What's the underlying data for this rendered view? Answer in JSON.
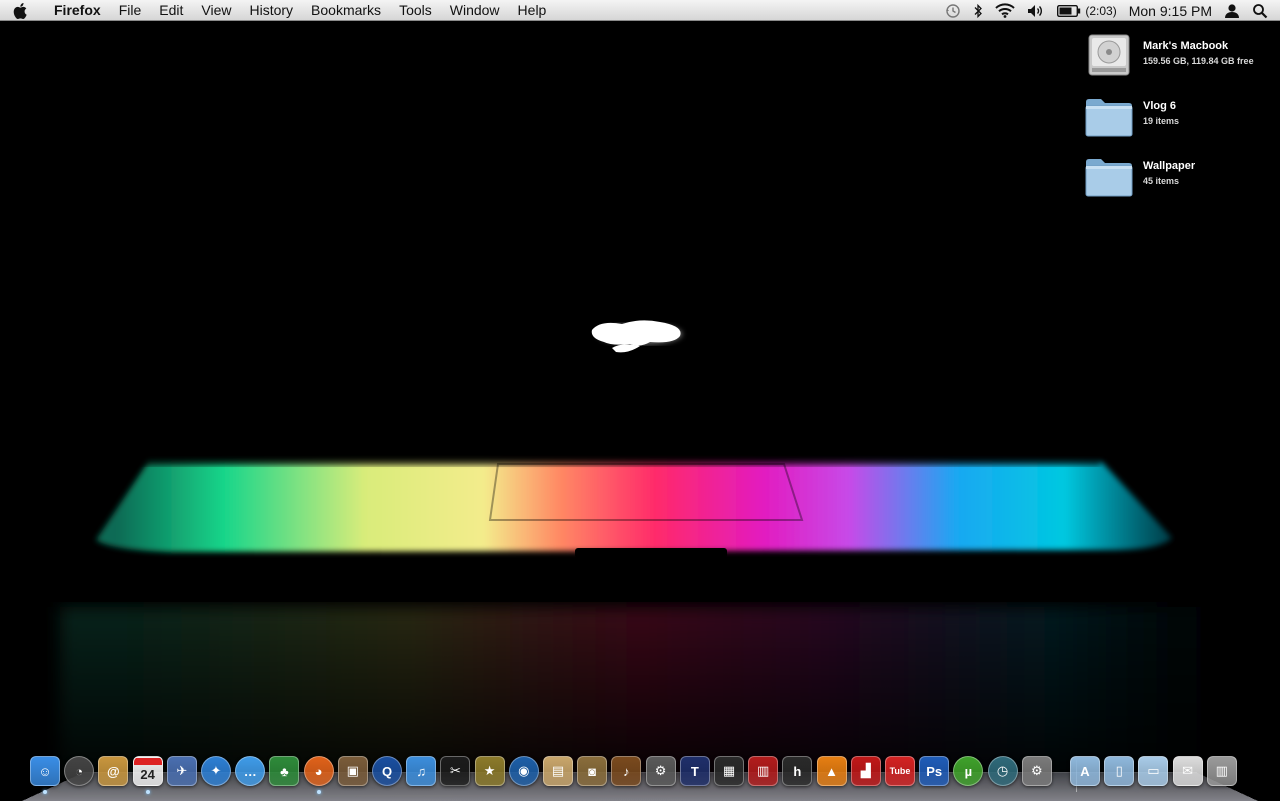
{
  "menubar": {
    "app_name": "Firefox",
    "menus": [
      "File",
      "Edit",
      "View",
      "History",
      "Bookmarks",
      "Tools",
      "Window",
      "Help"
    ],
    "battery_time": "(2:03)",
    "clock": "Mon 9:15 PM",
    "status_icons": [
      "time-machine-icon",
      "bluetooth-icon",
      "wifi-icon",
      "volume-icon",
      "battery-icon",
      "user-icon",
      "spotlight-icon"
    ]
  },
  "desktop": {
    "icons": [
      {
        "name": "Mark's Macbook",
        "info": "159.56 GB, 119.84 GB free",
        "icon": "hard-drive-icon"
      },
      {
        "name": "Vlog 6",
        "info": "19 items",
        "icon": "folder-icon"
      },
      {
        "name": "Wallpaper",
        "info": "45 items",
        "icon": "folder-icon"
      }
    ]
  },
  "dock": {
    "calendar_day": "24",
    "items": [
      {
        "icon": "finder-icon",
        "color": "#3a8ee6",
        "glyph": "☺",
        "running": true
      },
      {
        "icon": "dashboard-icon",
        "color": "#444444",
        "glyph": "◔",
        "running": false
      },
      {
        "icon": "address-book-icon",
        "color": "#c8963e",
        "glyph": "@",
        "running": false
      },
      {
        "icon": "ical-icon",
        "color": "#f2f2f2",
        "glyph": "",
        "running": true
      },
      {
        "icon": "mail-icon",
        "color": "#4a6fb0",
        "glyph": "✈",
        "running": false
      },
      {
        "icon": "safari-icon",
        "color": "#2d7fd4",
        "glyph": "✦",
        "running": false
      },
      {
        "icon": "ichat-icon",
        "color": "#3f9be8",
        "glyph": "…",
        "running": false
      },
      {
        "icon": "adium-icon",
        "color": "#2e8b3a",
        "glyph": "♣",
        "running": false
      },
      {
        "icon": "firefox-icon",
        "color": "#e0621a",
        "glyph": "◕",
        "running": true
      },
      {
        "icon": "preview-icon",
        "color": "#7a5c3a",
        "glyph": "▣",
        "running": false
      },
      {
        "icon": "quicktime-icon",
        "color": "#1a4fa0",
        "glyph": "Q",
        "running": false
      },
      {
        "icon": "itunes-icon",
        "color": "#3c8edc",
        "glyph": "♫",
        "running": false
      },
      {
        "icon": "final-cut-icon",
        "color": "#1c1c1c",
        "glyph": "✂",
        "running": false
      },
      {
        "icon": "imovie-icon",
        "color": "#8c7a2a",
        "glyph": "★",
        "running": false
      },
      {
        "icon": "dvd-player-icon",
        "color": "#1d5fa8",
        "glyph": "◉",
        "running": false
      },
      {
        "icon": "keynote-icon",
        "color": "#c9a66b",
        "glyph": "▤",
        "running": false
      },
      {
        "icon": "iphoto-icon",
        "color": "#8a6d3b",
        "glyph": "◙",
        "running": false
      },
      {
        "icon": "garageband-icon",
        "color": "#7a4a1e",
        "glyph": "♪",
        "running": false
      },
      {
        "icon": "compressor-icon",
        "color": "#5a5a5a",
        "glyph": "⚙",
        "running": false
      },
      {
        "icon": "livetype-icon",
        "color": "#1f2f6a",
        "glyph": "T",
        "running": false
      },
      {
        "icon": "photo-booth-icon",
        "color": "#2a2a2a",
        "glyph": "▦",
        "running": false
      },
      {
        "icon": "front-row-icon",
        "color": "#b21c1c",
        "glyph": "▥",
        "running": false
      },
      {
        "icon": "hulu-desktop-icon",
        "color": "#2a2a2a",
        "glyph": "h",
        "running": false
      },
      {
        "icon": "vlc-icon",
        "color": "#e67e12",
        "glyph": "▲",
        "running": false
      },
      {
        "icon": "chair-icon",
        "color": "#c01818",
        "glyph": "▟",
        "running": false
      },
      {
        "icon": "youtube-icon",
        "color": "#d32222",
        "glyph": "Tube",
        "running": false
      },
      {
        "icon": "photoshop-icon",
        "color": "#1f5cb8",
        "glyph": "Ps",
        "running": false
      },
      {
        "icon": "utorrent-icon",
        "color": "#3fa12b",
        "glyph": "µ",
        "running": false
      },
      {
        "icon": "time-machine-icon",
        "color": "#2f6a7a",
        "glyph": "◷",
        "running": false
      },
      {
        "icon": "system-preferences-icon",
        "color": "#7a7a7a",
        "glyph": "⚙",
        "running": false
      },
      {
        "icon": "applications-folder-icon",
        "color": "#8fb8dc",
        "glyph": "A",
        "running": false
      },
      {
        "icon": "documents-folder-icon",
        "color": "#8fb8dc",
        "glyph": "▯",
        "running": false
      },
      {
        "icon": "downloads-folder-icon",
        "color": "#a8cbe8",
        "glyph": "▭",
        "running": false
      },
      {
        "icon": "mail-stack-icon",
        "color": "#dcdcdc",
        "glyph": "✉",
        "running": false
      },
      {
        "icon": "trash-icon",
        "color": "#9a9a9a",
        "glyph": "▥",
        "running": false
      }
    ]
  }
}
